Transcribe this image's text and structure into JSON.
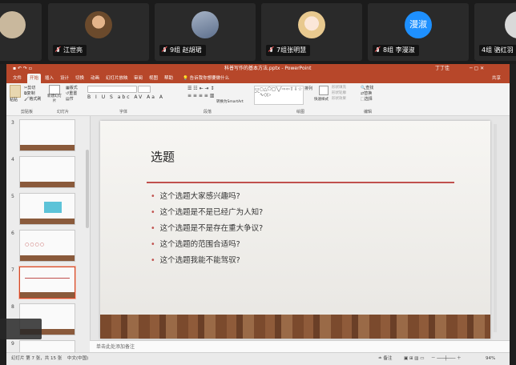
{
  "participants": [
    {
      "label": ""
    },
    {
      "label": "江世亮"
    },
    {
      "label": "9组 赵胡珺"
    },
    {
      "label": "7组张明慧"
    },
    {
      "label": "8组 李漫淑",
      "avatar_text": "漫淑"
    },
    {
      "label": "4组 骆红羽"
    }
  ],
  "ppt": {
    "window_title": "科普写作的基本方法.pptx - PowerPoint",
    "user": "丁丁佳",
    "share": "共享",
    "tabs": [
      "文件",
      "开始",
      "插入",
      "设计",
      "切换",
      "动画",
      "幻灯片放映",
      "审阅",
      "视图",
      "帮助"
    ],
    "tell_me": "告诉我你想要做什么",
    "ribbon": {
      "paste": "粘贴",
      "cut": "剪切",
      "copy": "复制",
      "format_painter": "格式刷",
      "new_slide": "新建幻灯片",
      "layout": "版式",
      "reset": "重置",
      "section": "节",
      "groups": {
        "clipboard": "剪贴板",
        "slides": "幻灯片",
        "font": "字体",
        "paragraph": "段落",
        "drawing": "绘图",
        "editing": "编辑"
      },
      "convert_smartart": "转换为SmartArt",
      "arrange": "排列",
      "quick_styles": "快速样式",
      "shape_fill": "形状填充",
      "shape_outline": "形状轮廓",
      "shape_effects": "形状效果",
      "find": "查找",
      "replace": "替换",
      "select": "选择"
    },
    "thumbnails": [
      {
        "num": "3"
      },
      {
        "num": "4"
      },
      {
        "num": "5"
      },
      {
        "num": "6"
      },
      {
        "num": "7"
      },
      {
        "num": "8"
      },
      {
        "num": "9"
      }
    ],
    "slide": {
      "title": "选题",
      "bullets": [
        "这个选题大家感兴趣吗?",
        "这个选题是不是已经广为人知?",
        "这个选题是不是存在重大争议?",
        "这个选题的范围合适吗?",
        "这个选题我能不能驾驭?"
      ]
    },
    "notes_placeholder": "单击此处添加备注",
    "status": {
      "slide_info": "幻灯片 第 7 张，共 15 张",
      "language": "中文(中国)",
      "notes": "备注",
      "zoom": "94%"
    }
  }
}
